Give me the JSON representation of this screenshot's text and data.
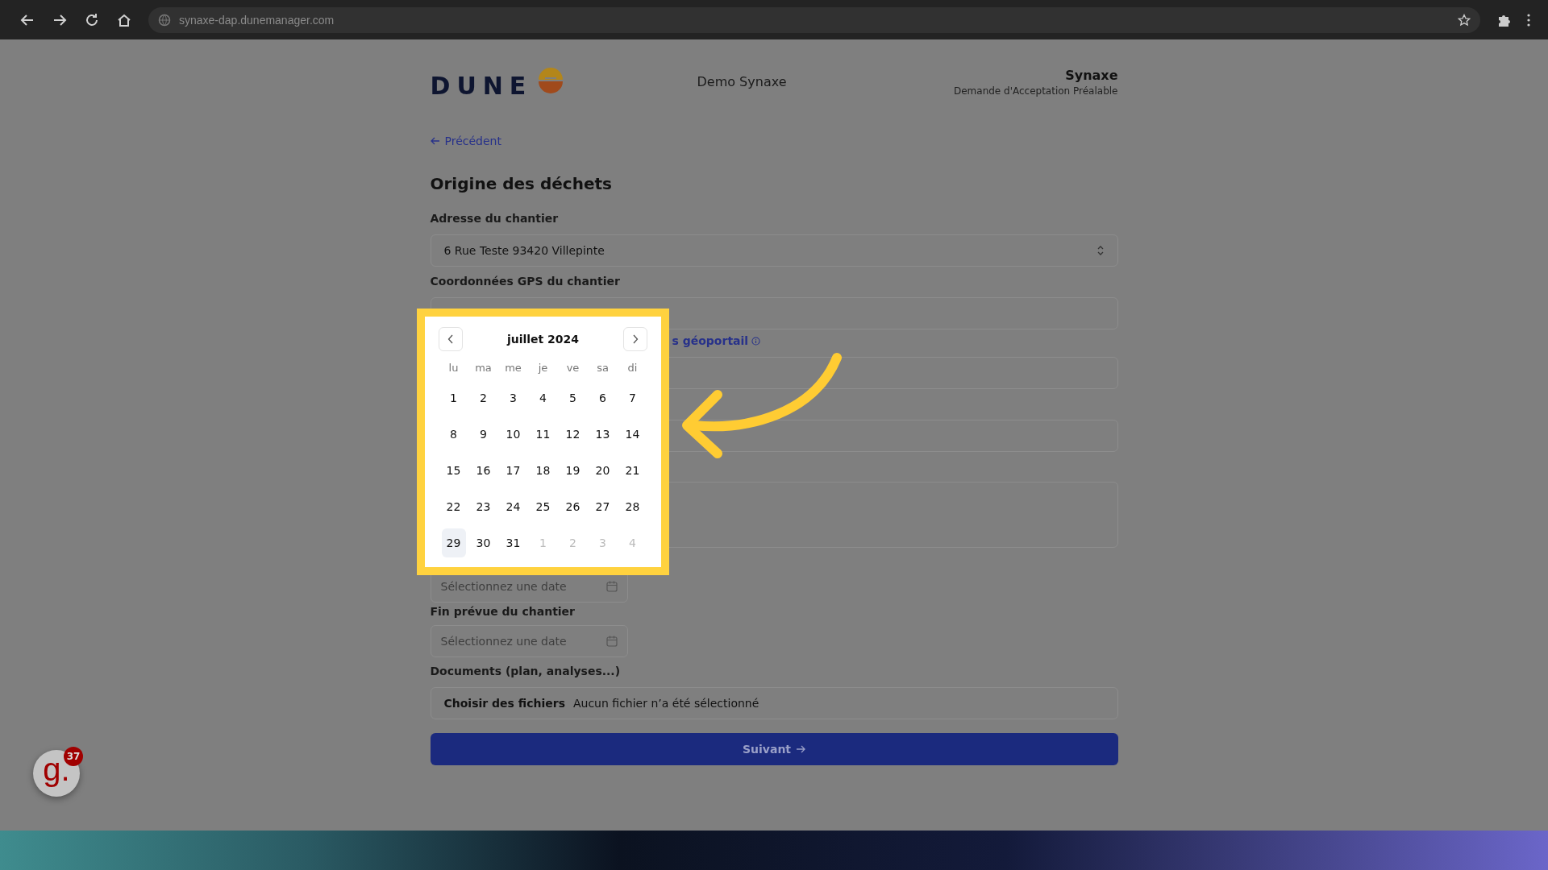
{
  "browser": {
    "url": "synaxe-dap.dunemanager.com"
  },
  "header": {
    "logo": "DUNE",
    "center_title": "Demo Synaxe",
    "org": "Synaxe",
    "subtitle": "Demande d'Acceptation Préalable"
  },
  "back_link": "Précédent",
  "section_title": "Origine des déchets",
  "address": {
    "label": "Adresse du chantier",
    "value": "6 Rue Teste 93420 Villepinte"
  },
  "gps": {
    "label": "Coordonnées GPS du chantier"
  },
  "geoportail_link": "s géoportail",
  "date_start": {
    "placeholder": "Sélectionnez une date"
  },
  "date_end": {
    "label": "Fin prévue du chantier",
    "placeholder": "Sélectionnez une date"
  },
  "documents": {
    "label": "Documents (plan, analyses...)",
    "button": "Choisir des fichiers",
    "status": "Aucun fichier n’a été sélectionné"
  },
  "submit": "Suivant",
  "calendar": {
    "month": "juillet 2024",
    "weekdays": [
      "lu",
      "ma",
      "me",
      "je",
      "ve",
      "sa",
      "di"
    ],
    "weeks": [
      [
        {
          "label": "1",
          "outside": false,
          "today": false
        },
        {
          "label": "2",
          "outside": false,
          "today": false
        },
        {
          "label": "3",
          "outside": false,
          "today": false
        },
        {
          "label": "4",
          "outside": false,
          "today": false
        },
        {
          "label": "5",
          "outside": false,
          "today": false
        },
        {
          "label": "6",
          "outside": false,
          "today": false
        },
        {
          "label": "7",
          "outside": false,
          "today": false
        }
      ],
      [
        {
          "label": "8",
          "outside": false,
          "today": false
        },
        {
          "label": "9",
          "outside": false,
          "today": false
        },
        {
          "label": "10",
          "outside": false,
          "today": false
        },
        {
          "label": "11",
          "outside": false,
          "today": false
        },
        {
          "label": "12",
          "outside": false,
          "today": false
        },
        {
          "label": "13",
          "outside": false,
          "today": false
        },
        {
          "label": "14",
          "outside": false,
          "today": false
        }
      ],
      [
        {
          "label": "15",
          "outside": false,
          "today": false
        },
        {
          "label": "16",
          "outside": false,
          "today": false
        },
        {
          "label": "17",
          "outside": false,
          "today": false
        },
        {
          "label": "18",
          "outside": false,
          "today": false
        },
        {
          "label": "19",
          "outside": false,
          "today": false
        },
        {
          "label": "20",
          "outside": false,
          "today": false
        },
        {
          "label": "21",
          "outside": false,
          "today": false
        }
      ],
      [
        {
          "label": "22",
          "outside": false,
          "today": false
        },
        {
          "label": "23",
          "outside": false,
          "today": false
        },
        {
          "label": "24",
          "outside": false,
          "today": false
        },
        {
          "label": "25",
          "outside": false,
          "today": false
        },
        {
          "label": "26",
          "outside": false,
          "today": false
        },
        {
          "label": "27",
          "outside": false,
          "today": false
        },
        {
          "label": "28",
          "outside": false,
          "today": false
        }
      ],
      [
        {
          "label": "29",
          "outside": false,
          "today": true
        },
        {
          "label": "30",
          "outside": false,
          "today": false
        },
        {
          "label": "31",
          "outside": false,
          "today": false
        },
        {
          "label": "1",
          "outside": true,
          "today": false
        },
        {
          "label": "2",
          "outside": true,
          "today": false
        },
        {
          "label": "3",
          "outside": true,
          "today": false
        },
        {
          "label": "4",
          "outside": true,
          "today": false
        }
      ]
    ]
  },
  "help_widget": {
    "logo": "g.",
    "count": "37"
  }
}
